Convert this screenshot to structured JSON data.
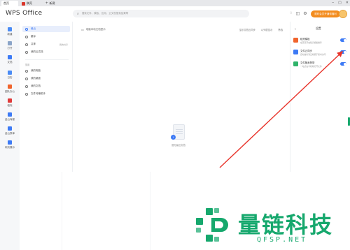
{
  "tabs": {
    "home": "首页",
    "doc": "稿壳",
    "new": "新建"
  },
  "header": {
    "logo": "WPS Office",
    "search_placeholder": "搜索文件、模板、应用、云文档搜索结果等",
    "member_button": "限时会员开通领福利"
  },
  "leftnav": [
    {
      "label": "新建",
      "icon": "new-icon"
    },
    {
      "label": "打开",
      "icon": "open-icon"
    },
    {
      "label": "文档",
      "icon": "document-icon",
      "active": true
    },
    {
      "label": "日历",
      "icon": "calendar-icon"
    },
    {
      "label": "团队办公",
      "icon": "team-icon"
    },
    {
      "label": "稻壳",
      "icon": "docer-icon"
    },
    {
      "label": "金山海报",
      "icon": "poster-icon"
    },
    {
      "label": "金山表单",
      "icon": "form-icon"
    },
    {
      "label": "网页展示",
      "icon": "web-icon"
    }
  ],
  "subnav": {
    "items": [
      {
        "label": "最近",
        "active": true
      },
      {
        "label": "星标"
      },
      {
        "label": "共享",
        "extra": "我的共享"
      },
      {
        "label": "我的云文档"
      }
    ],
    "section_label": "常用",
    "places": [
      {
        "label": "我的电脑"
      },
      {
        "label": "我的桌面"
      },
      {
        "label": "我的文档"
      },
      {
        "label": "文件传输助手"
      }
    ]
  },
  "main": {
    "breadcrumb": "电脑本地文档显示",
    "tools": [
      "显示文档云同步",
      "以列表显示",
      "筛选"
    ],
    "empty_text": "暂无最近文档"
  },
  "rightpanel": {
    "title": "设置",
    "items": [
      {
        "title": "稻壳模板",
        "subtitle": "在首页开启稻壳模板推荐",
        "icon": "docer-template-icon",
        "color": "#f0642d",
        "on": true
      },
      {
        "title": "文件云同步",
        "subtitle": "自动备份到云端便于随时访问",
        "icon": "cloud-sync-icon",
        "color": "#3d7af5",
        "on": true
      },
      {
        "title": "文件随身携带",
        "subtitle": "一站式在手机端打开文件",
        "icon": "carry-file-icon",
        "color": "#2fb36a",
        "on": true
      }
    ]
  },
  "watermark": {
    "name": "量链科技",
    "url": "QFSP.NET",
    "color": "#16a86d"
  },
  "colors": {
    "accent": "#3d7af5",
    "arrow": "#e8332a",
    "member": "#f38c1e"
  }
}
